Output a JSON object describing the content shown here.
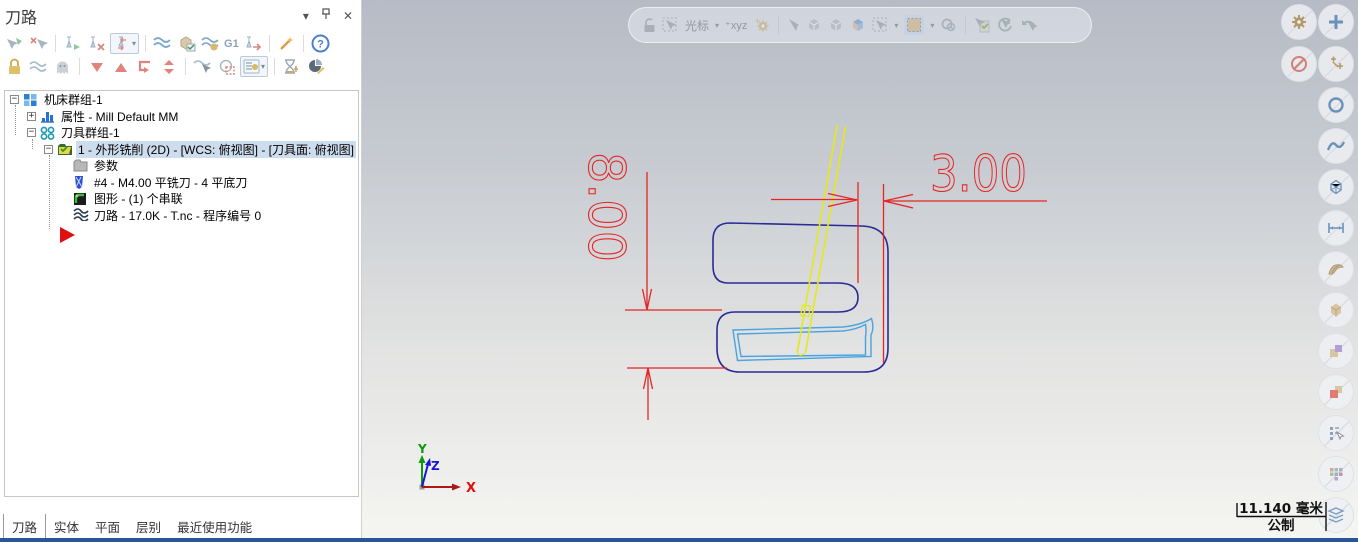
{
  "panel": {
    "title": "刀路",
    "controls": {
      "collapse": "dropdown-icon",
      "pin": "pin-icon",
      "close": "close-icon"
    },
    "toolbar": {
      "g1_label": "G1",
      "row1_icons": [
        "select-all-operations",
        "deselect-all-operations",
        "regenerate-selected",
        "invalidate-selected",
        "toolpath-locate-dropdown",
        "backplot-toolpath",
        "verify-solid",
        "simulate-options",
        "g1-code",
        "post-process",
        "edit-wand",
        "help"
      ],
      "row2_icons": [
        "lock-toolpath",
        "toggle-toolpath-display",
        "ghost-toolpath",
        "move-down",
        "move-up",
        "move-insert",
        "swap-order",
        "toolpath-display-cursor",
        "chain-geometry",
        "options-list-dropdown",
        "batch-process",
        "material-edit"
      ]
    },
    "tree": {
      "rows": [
        {
          "label": "机床群组-1",
          "level": 0,
          "expand": "minus",
          "icon": "machine-group-icon",
          "selected": false
        },
        {
          "label": "属性 - Mill Default MM",
          "level": 1,
          "expand": "plus",
          "icon": "properties-icon",
          "selected": false
        },
        {
          "label": "刀具群组-1",
          "level": 1,
          "expand": "minus",
          "icon": "tool-group-icon",
          "selected": false
        },
        {
          "label": "1 - 外形铣削 (2D) - [WCS: 俯视图] - [刀具面: 俯视图]",
          "level": 2,
          "expand": "minus",
          "icon": "operation-icon",
          "selected": true
        },
        {
          "label": "参数",
          "level": 3,
          "expand": "none",
          "icon": "parameters-folder-icon",
          "selected": false
        },
        {
          "label": "#4 - M4.00 平铣刀 - 4 平底刀",
          "level": 3,
          "expand": "none",
          "icon": "tool-icon",
          "selected": false
        },
        {
          "label": "图形 - (1) 个串联",
          "level": 3,
          "expand": "none",
          "icon": "geometry-icon",
          "selected": false
        },
        {
          "label": "刀路 - 17.0K - T.nc - 程序编号 0",
          "level": 3,
          "expand": "none",
          "icon": "toolpath-file-icon",
          "selected": false
        }
      ],
      "insert_marker": "red-arrow"
    },
    "tabs": [
      {
        "label": "刀路",
        "active": true
      },
      {
        "label": "实体",
        "active": false
      },
      {
        "label": "平面",
        "active": false
      },
      {
        "label": "层别",
        "active": false
      },
      {
        "label": "最近使用功能",
        "active": false
      }
    ]
  },
  "selection_bar": {
    "cursor_label": "光标",
    "xyz_label": "xyz",
    "icons": [
      "lock",
      "cursor-box",
      "cursor-dropdown",
      "xyz-point",
      "gear-add",
      "select-arrow",
      "cube-check",
      "cube",
      "cube-colored",
      "select-box-dropdown",
      "window-select-dropdown",
      "quick-circles",
      "select-validate",
      "regenerate",
      "undo-select"
    ]
  },
  "right_rail": {
    "buttons": [
      "gear-settings",
      "add-plus",
      "block-selection",
      "move-points",
      "circle-mask",
      "spline-mask",
      "wireframe-mask",
      "dimension-mask",
      "surface-mask",
      "solid-mask",
      "planes-purple",
      "planes-red",
      "list-select",
      "color-grid",
      "levels-mask"
    ]
  },
  "viewport": {
    "dimensions": {
      "height_label": "8.00",
      "width_label": "3.00"
    },
    "axes": {
      "x": "X",
      "y": "Y",
      "z": "Z"
    },
    "scale": {
      "value": "11.140 毫米",
      "units": "公制"
    }
  },
  "colors": {
    "part_outline": "#2a2a99",
    "toolpath": "#4aa3e0",
    "tool": "#e8e816",
    "dimension": "#e52525",
    "axis_x": "#b01818",
    "axis_y": "#0a9a0a",
    "axis_z": "#1515dd",
    "accent_bottom_bar": "#2a5699",
    "selection_highlight": "#cdddee"
  }
}
